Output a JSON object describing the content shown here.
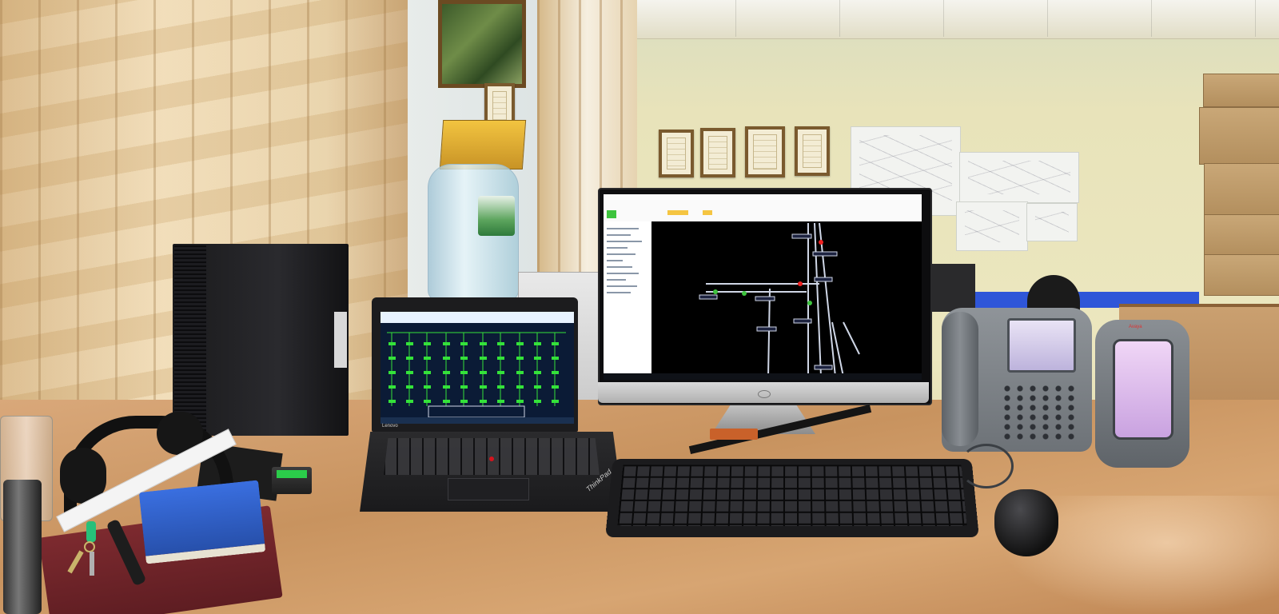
{
  "scene": {
    "description_tag": "office desk with monitors and phones"
  },
  "laptop": {
    "brand": "Lenovo",
    "trackpad_brand": "ThinkPad",
    "screen_app": "network schematic (green nodes)"
  },
  "phone2": {
    "brand": "Avaya"
  },
  "colors": {
    "wall": "#e9e1b8",
    "desk": "#c8935f",
    "schematic_green": "#34e23a",
    "monitor_lines": "#cfd6e6",
    "label_box": "#1d2340",
    "phone_screen": "#c9bde6"
  }
}
